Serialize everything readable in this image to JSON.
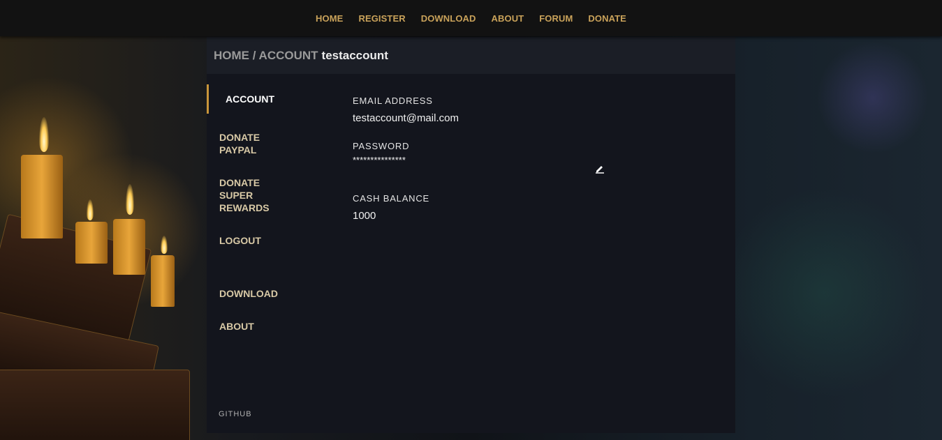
{
  "nav": {
    "items": [
      "HOME",
      "REGISTER",
      "DOWNLOAD",
      "ABOUT",
      "FORUM",
      "DONATE"
    ]
  },
  "breadcrumb": {
    "path": "HOME / ACCOUNT",
    "user": "testaccount"
  },
  "sidebar": {
    "items": [
      {
        "label": "ACCOUNT",
        "active": true
      },
      {
        "label": "DONATE\nPAYPAL"
      },
      {
        "label": "DONATE\nSUPER\nREWARDS"
      },
      {
        "label": "LOGOUT"
      },
      {
        "label": "DOWNLOAD"
      },
      {
        "label": "ABOUT"
      }
    ],
    "footer": "GITHUB"
  },
  "account": {
    "email_label": "EMAIL ADDRESS",
    "email_value": "testaccount@mail.com",
    "password_label": "PASSWORD",
    "password_value": "***************",
    "cash_label": "CASH BALANCE",
    "cash_value": "1000",
    "edit_icon": "pencil-edit-icon"
  },
  "colors": {
    "accent": "#c9a25a",
    "active_border": "#c9963a",
    "panel_bg": "#13151d",
    "header_bg": "#121212"
  }
}
